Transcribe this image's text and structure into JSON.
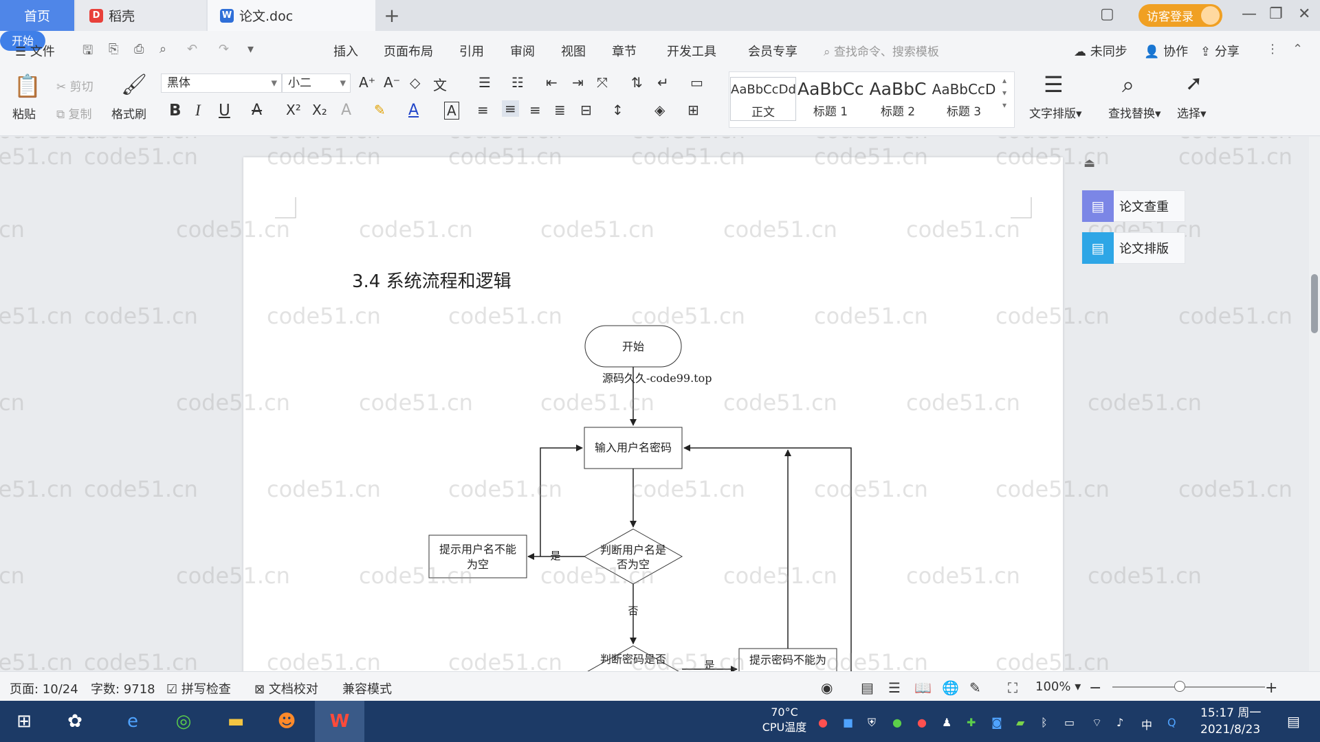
{
  "tabs": {
    "home": "首页",
    "daoke": "稻壳",
    "doc": "论文.doc",
    "add": "+"
  },
  "titlebar": {
    "login": "访客登录"
  },
  "menu": {
    "file": "文件",
    "items": [
      "开始",
      "插入",
      "页面布局",
      "引用",
      "审阅",
      "视图",
      "章节",
      "开发工具",
      "会员专享"
    ],
    "search_placeholder": "查找命令、搜索模板",
    "unsynced": "未同步",
    "collab": "协作",
    "share": "分享"
  },
  "ribbon": {
    "paste": "粘贴",
    "cut": "剪切",
    "copy": "复制",
    "format_painter": "格式刷",
    "font_name": "黑体",
    "font_size": "小二",
    "styles": [
      {
        "sample": "AaBbCcDd",
        "name": "正文"
      },
      {
        "sample": "AaBbCc",
        "name": "标题 1"
      },
      {
        "sample": "AaBbC",
        "name": "标题 2"
      },
      {
        "sample": "AaBbCcD",
        "name": "标题 3"
      }
    ],
    "text_layout": "文字排版",
    "find_replace": "查找替换",
    "select": "选择"
  },
  "document": {
    "section_title": "3.4 系统流程和逻辑",
    "watermark": "code51.cn",
    "source_note": "源码久久-code99.top",
    "flow": {
      "start": "开始",
      "input": "输入用户名密码",
      "check_user_l1": "判断用户名是",
      "check_user_l2": "否为空",
      "user_empty_l1": "提示用户名不能",
      "user_empty_l2": "为空",
      "yes": "是",
      "no": "否",
      "check_pwd": "判断密码是否",
      "yes2": "是",
      "pwd_empty": "提示密码不能为"
    }
  },
  "side": {
    "check": "论文查重",
    "layout": "论文排版"
  },
  "status": {
    "page": "页面: 10/24",
    "words": "字数: 9718",
    "spell": "拼写检查",
    "proof": "文档校对",
    "compat": "兼容模式",
    "zoom": "100%"
  },
  "taskbar": {
    "cpu_temp": "70°C",
    "cpu_label": "CPU温度",
    "time": "15:17 周一",
    "date": "2021/8/23"
  }
}
